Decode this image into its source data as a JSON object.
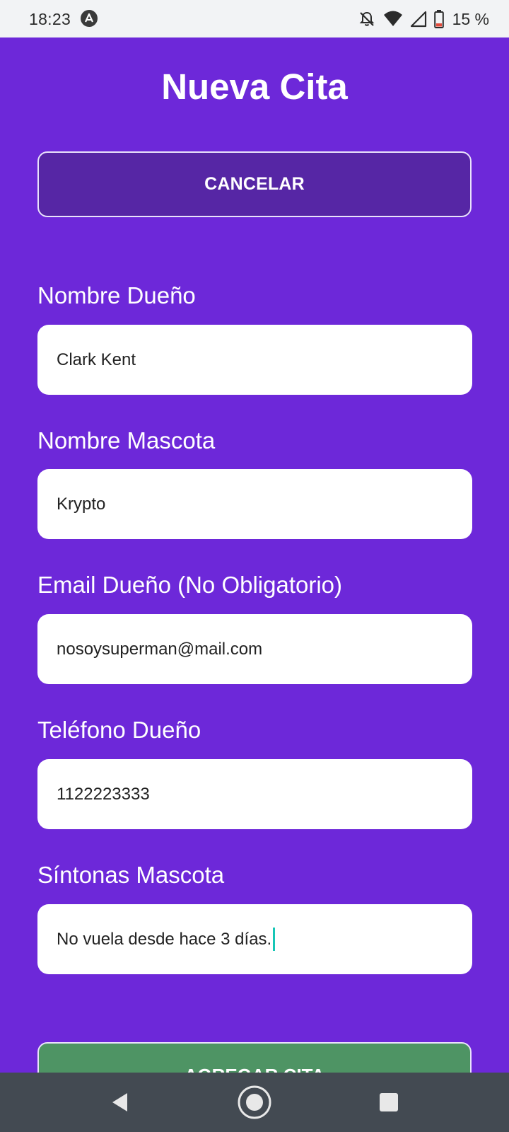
{
  "status_bar": {
    "time": "18:23",
    "battery_text": "15 %",
    "icons": [
      "app-notification-icon",
      "notifications-off-icon",
      "wifi-icon",
      "cell-signal-icon",
      "battery-icon"
    ]
  },
  "header": {
    "title": "Nueva Cita"
  },
  "actions": {
    "cancel_label": "CANCELAR",
    "add_label": "AGREGAR CITA"
  },
  "form": {
    "owner_name": {
      "label": "Nombre Dueño",
      "value": "Clark Kent"
    },
    "pet_name": {
      "label": "Nombre Mascota",
      "value": "Krypto"
    },
    "owner_email": {
      "label": "Email Dueño (No Obligatorio)",
      "value": "nosoysuperman@mail.com"
    },
    "owner_phone": {
      "label": "Teléfono Dueño",
      "value": "1122223333"
    },
    "pet_symptoms": {
      "label": "Síntonas Mascota",
      "value": "No vuela desde hace 3 días."
    }
  },
  "navigation": {
    "icons": [
      "back-icon",
      "home-icon",
      "recents-icon"
    ]
  },
  "colors": {
    "background": "#6d28d9",
    "cancel_button": "#5626a5",
    "add_button": "#4e9464",
    "caret": "#16c6b6",
    "status_bar": "#f2f3f5",
    "nav_bar": "#434a52"
  }
}
